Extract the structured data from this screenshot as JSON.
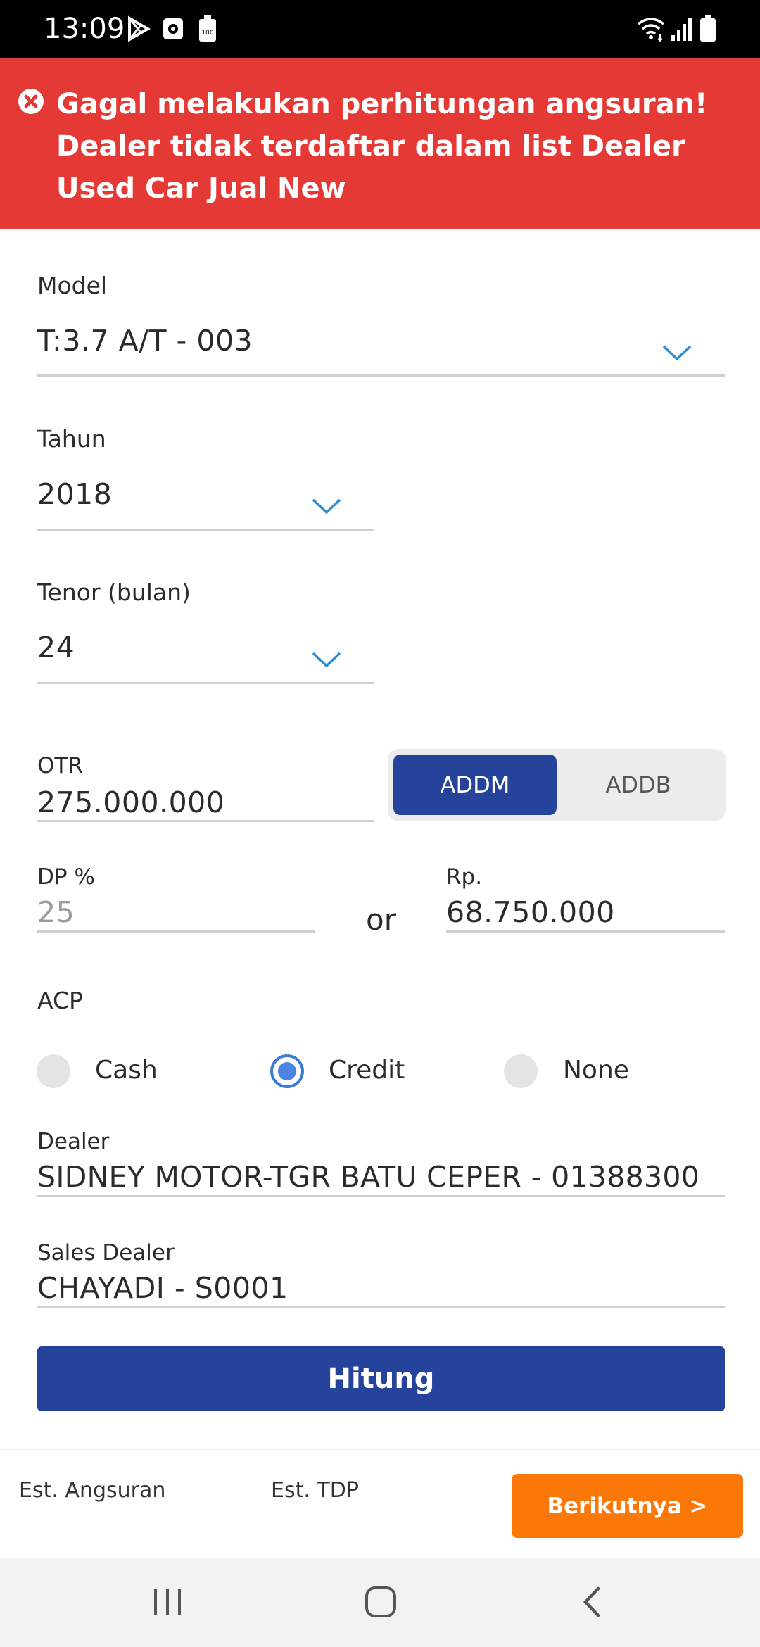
{
  "status_bar": {
    "time": "13:09",
    "battery_badge": "100"
  },
  "error_banner": {
    "message": "Gagal melakukan perhitungan angsuran! Dealer tidak terdaftar dalam list Dealer Used Car Jual New"
  },
  "form": {
    "model": {
      "label": "Model",
      "value": "T:3.7 A/T - 003"
    },
    "tahun": {
      "label": "Tahun",
      "value": "2018"
    },
    "tenor": {
      "label": "Tenor (bulan)",
      "value": "24"
    },
    "otr": {
      "label": "OTR",
      "value": "275.000.000"
    },
    "addm_toggle": {
      "options": [
        "ADDM",
        "ADDB"
      ],
      "selected": "ADDM"
    },
    "dp_percent": {
      "label": "DP %",
      "value": "25"
    },
    "or_label": "or",
    "dp_rp": {
      "label": "Rp.",
      "value": "68.750.000"
    },
    "acp": {
      "label": "ACP",
      "options": [
        "Cash",
        "Credit",
        "None"
      ],
      "selected": "Credit"
    },
    "dealer": {
      "label": "Dealer",
      "value": "SIDNEY MOTOR-TGR BATU CEPER - 01388300"
    },
    "sales_dealer": {
      "label": "Sales Dealer",
      "value": "CHAYADI - S0001"
    },
    "hitung_label": "Hitung"
  },
  "summary": {
    "est_angsuran_label": "Est. Angsuran",
    "est_tdp_label": "Est. TDP",
    "next_label": "Berikutnya >"
  },
  "colors": {
    "error": "#e53935",
    "primary": "#25439a",
    "accent": "#fb7708",
    "chevron": "#2a8fd0",
    "radio": "#4a86e0"
  },
  "icons": [
    "play-store-icon",
    "screen-record-icon",
    "battery-saver-icon",
    "wifi-icon",
    "signal-icon",
    "battery-icon",
    "error-icon",
    "chevron-down-icon",
    "recent-apps-icon",
    "home-icon",
    "back-icon"
  ]
}
